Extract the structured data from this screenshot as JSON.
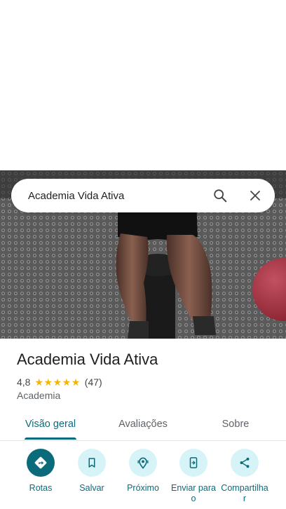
{
  "search": {
    "query": "Academia Vida Ativa"
  },
  "place": {
    "name": "Academia Vida Ativa",
    "rating": "4,8",
    "stars": 5,
    "review_count": "(47)",
    "category": "Academia"
  },
  "tabs": [
    {
      "label": "Visão geral",
      "active": true
    },
    {
      "label": "Avaliações",
      "active": false
    },
    {
      "label": "Sobre",
      "active": false
    }
  ],
  "actions": [
    {
      "label": "Rotas",
      "icon": "directions-icon"
    },
    {
      "label": "Salvar",
      "icon": "bookmark-icon"
    },
    {
      "label": "Próximo",
      "icon": "nearby-icon"
    },
    {
      "label": "Enviar para\no",
      "icon": "send-to-phone-icon"
    },
    {
      "label": "Compartilha\nr",
      "icon": "share-icon"
    }
  ],
  "colors": {
    "accent": "#0b6b7a",
    "accent_light": "#d6f4f8",
    "star": "#f5b400"
  }
}
